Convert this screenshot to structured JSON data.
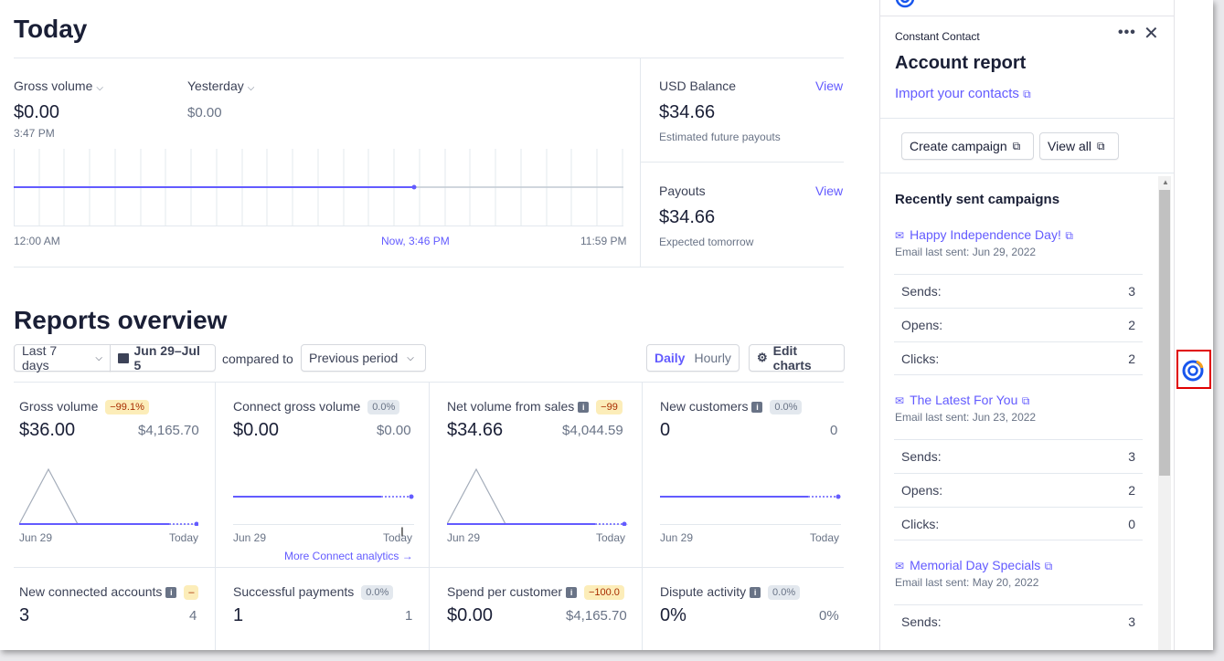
{
  "today": {
    "title": "Today",
    "gross_label": "Gross volume",
    "gross_value": "$0.00",
    "gross_time": "3:47 PM",
    "yesterday_label": "Yesterday",
    "yesterday_value": "$0.00",
    "axis_start": "12:00 AM",
    "axis_now": "Now, 3:46 PM",
    "axis_end": "11:59 PM",
    "balance": {
      "label": "USD Balance",
      "view": "View",
      "value": "$34.66",
      "note": "Estimated future payouts"
    },
    "payouts": {
      "label": "Payouts",
      "view": "View",
      "value": "$34.66",
      "note": "Expected tomorrow"
    }
  },
  "reports": {
    "title": "Reports overview",
    "range_select": "Last 7 days",
    "date_range": "Jun 29–Jul 5",
    "compared_to": "compared to",
    "compare_select": "Previous period",
    "daily": "Daily",
    "hourly": "Hourly",
    "edit_charts": "Edit charts",
    "cards": [
      {
        "title": "Gross volume",
        "badge": "−99.1%",
        "value": "$36.00",
        "prev": "$4,165.70",
        "start": "Jun 29",
        "end": "Today"
      },
      {
        "title": "Connect gross volume",
        "badge": "0.0%",
        "value": "$0.00",
        "prev": "$0.00",
        "start": "Jun 29",
        "end": "Today",
        "more": "More Connect analytics →"
      },
      {
        "title": "Net volume from sales",
        "badge": "−99",
        "value": "$34.66",
        "prev": "$4,044.59",
        "start": "Jun 29",
        "end": "Today"
      },
      {
        "title": "New customers",
        "badge": "0.0%",
        "value": "0",
        "prev": "0",
        "start": "Jun 29",
        "end": "Today"
      },
      {
        "title": "New connected accounts",
        "badge": "–",
        "value": "3",
        "prev": "4"
      },
      {
        "title": "Successful payments",
        "badge": "0.0%",
        "value": "1",
        "prev": "1"
      },
      {
        "title": "Spend per customer",
        "badge": "−100.0",
        "value": "$0.00",
        "prev": "$4,165.70"
      },
      {
        "title": "Dispute activity",
        "badge": "0.0%",
        "value": "0%",
        "prev": "0%"
      }
    ]
  },
  "panel": {
    "app_name": "Constant Contact",
    "title": "Account report",
    "import_link": "Import your contacts",
    "create_campaign": "Create campaign",
    "view_all": "View all",
    "recent_title": "Recently sent campaigns",
    "campaigns": [
      {
        "name": "Happy Independence Day!",
        "sent": "Email last sent: Jun 29, 2022",
        "stats": [
          {
            "k": "Sends:",
            "v": "3"
          },
          {
            "k": "Opens:",
            "v": "2"
          },
          {
            "k": "Clicks:",
            "v": "2"
          }
        ]
      },
      {
        "name": "The Latest For You",
        "sent": "Email last sent: Jun 23, 2022",
        "stats": [
          {
            "k": "Sends:",
            "v": "3"
          },
          {
            "k": "Opens:",
            "v": "2"
          },
          {
            "k": "Clicks:",
            "v": "0"
          }
        ]
      },
      {
        "name": "Memorial Day Specials",
        "sent": "Email last sent: May 20, 2022",
        "stats": [
          {
            "k": "Sends:",
            "v": "3"
          }
        ]
      }
    ]
  },
  "colors": {
    "accent": "#635bff",
    "rail_highlight": "#e00000"
  }
}
